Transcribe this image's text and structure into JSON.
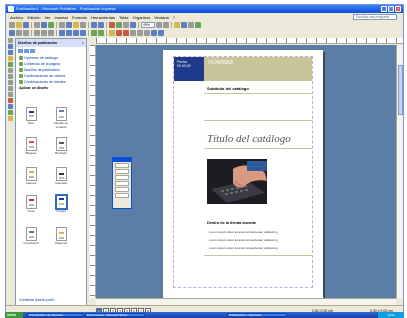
{
  "window": {
    "title": "Publicación1 - Microsoft Publisher - Publicación impresa",
    "controls": [
      "_",
      "□",
      "×"
    ]
  },
  "menu": {
    "items": [
      "Archivo",
      "Edición",
      "Ver",
      "Insertar",
      "Formato",
      "Herramientas",
      "Tabla",
      "Organizar",
      "Ventana",
      "?"
    ],
    "help_placeholder": "Escriba una pregunta"
  },
  "toolbar": {
    "zoom": "49%"
  },
  "task_pane": {
    "title": "Diseños de publicación",
    "close": "×",
    "tasks": [
      "Opciones de catálogo",
      "Contenido de la página",
      "Diseños de publicación",
      "Combinaciones de colores",
      "Combinaciones de fuentes"
    ],
    "section_label": "Aplicar un diseño",
    "footer_link": "Combinar diseño publi..."
  },
  "thumbnails": [
    {
      "caption": "Ático"
    },
    {
      "caption": "Mueble de ventana"
    },
    {
      "caption": "Bloques"
    },
    {
      "caption": "Brackets"
    },
    {
      "caption": "Captura"
    },
    {
      "caption": "Cascada"
    },
    {
      "caption": "Cinta"
    },
    {
      "caption": "Ciudad"
    },
    {
      "caption": "Crosshatch"
    },
    {
      "caption": "Diagonal"
    }
  ],
  "document": {
    "date_block": "Fecha\n00.00.00",
    "name_block": "NOMBRE",
    "subtitle": "Subtítulo del catálogo",
    "catalog_title": "Título del catálogo",
    "section_title": "Dentro de la tienda durante",
    "bullets": [
      "Lorem ipsum dolor sit amet consectetuer adipiscing",
      "Lorem ipsum dolor sit amet consectetuer adipiscing",
      "Lorem ipsum dolor sit amet consectetuer adipiscing"
    ]
  },
  "statusbar": {
    "pages": [
      "1",
      "2",
      "3",
      "4",
      "5",
      "6",
      "7",
      "8"
    ],
    "current_page": "1",
    "position": "0,00; 0,00 cm",
    "size": "0,00 x 0,00 cm"
  },
  "taskbar": {
    "start": "inicio",
    "tasks": [
      "3 Explorador de Windows",
      "Documento1 - Microsoft Word",
      "Publicación1 - Microsoft"
    ],
    "clock": "12:00"
  },
  "colors": {
    "navy": "#1f3a8a",
    "olive": "#c9c49a",
    "workspace": "#5c7ea6"
  }
}
